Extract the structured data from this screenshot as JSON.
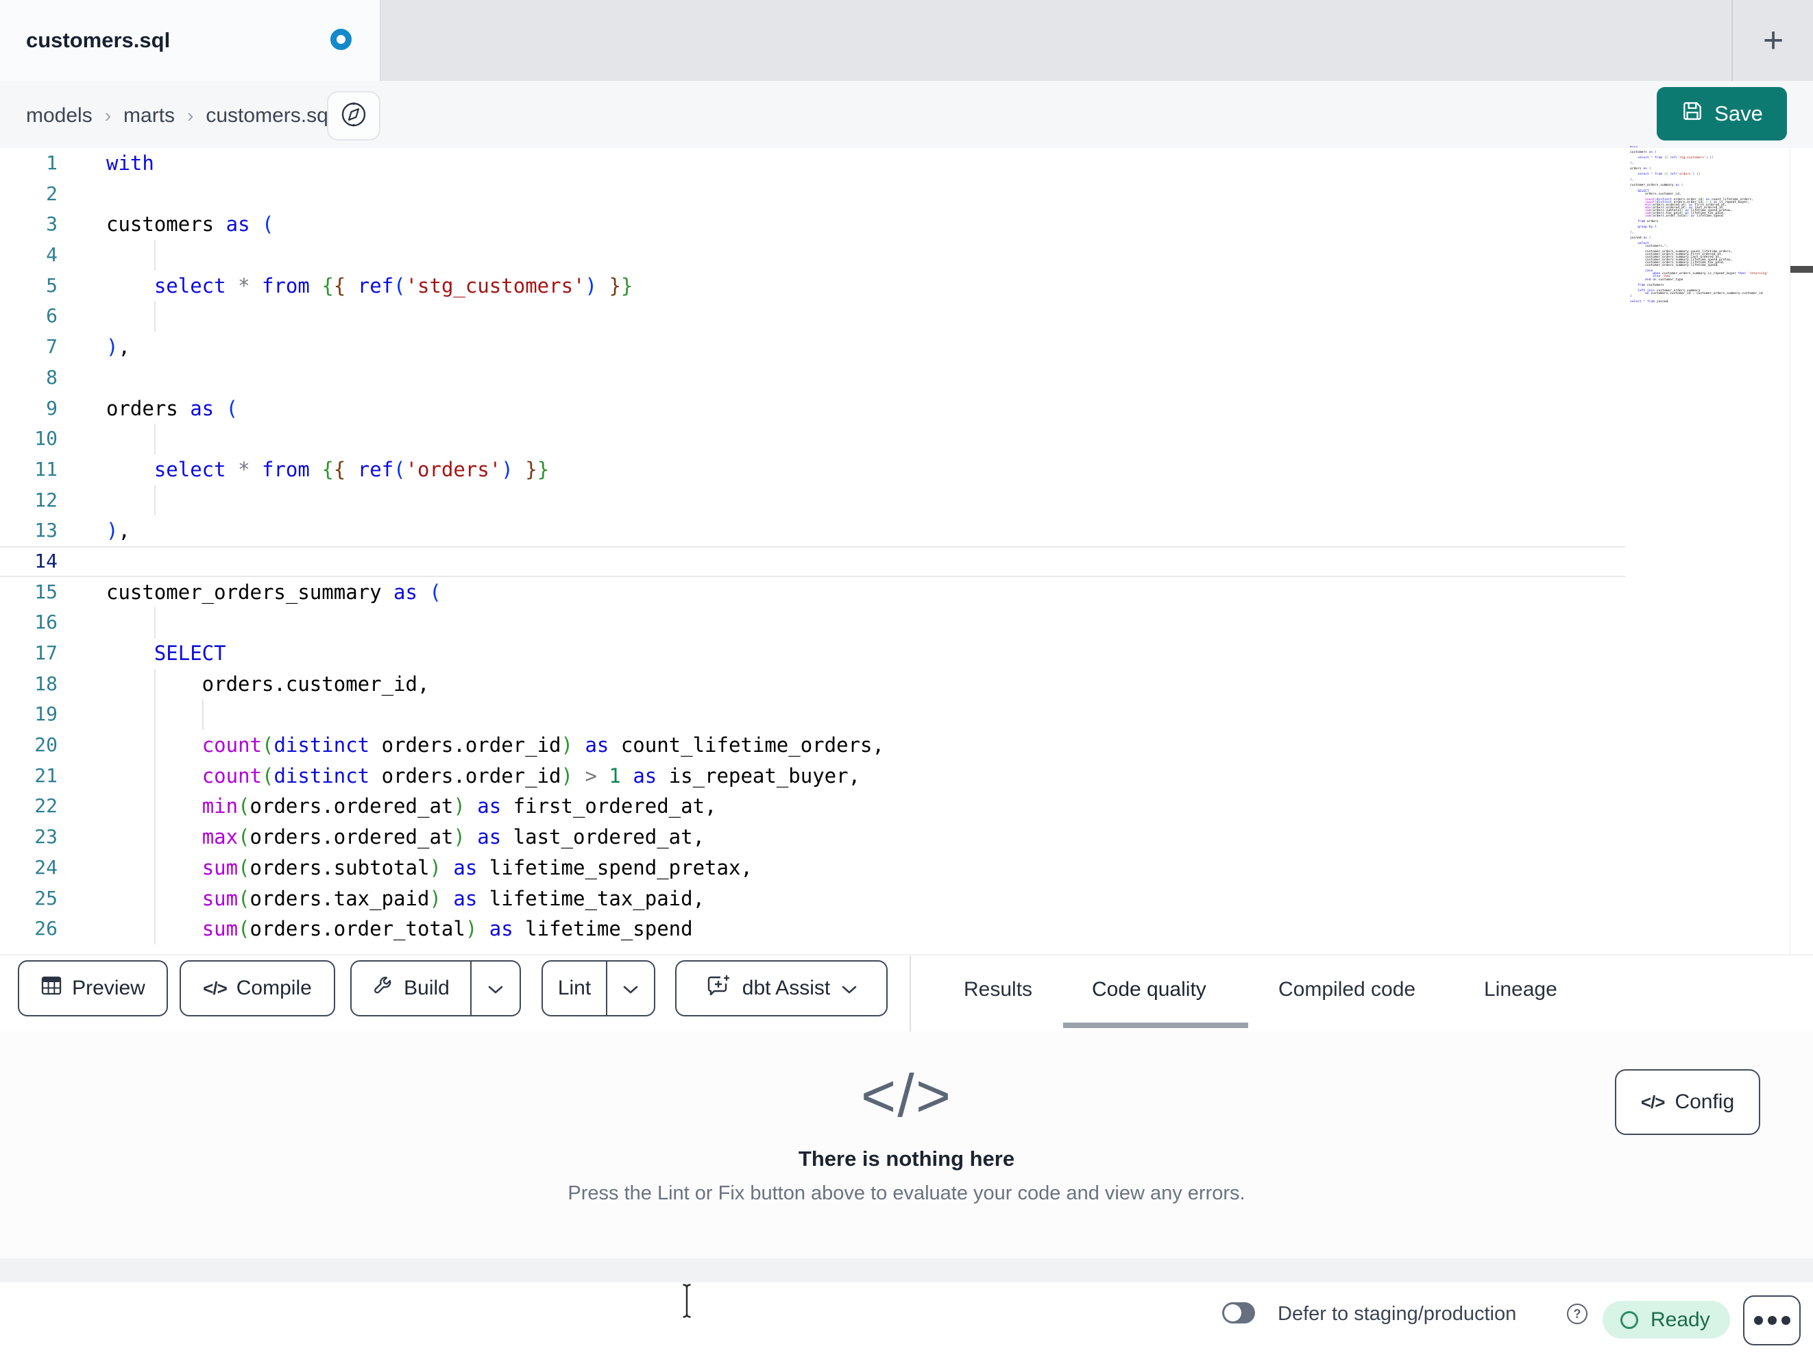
{
  "tabbar": {
    "tab_title": "customers.sql",
    "new_tab_label": "+"
  },
  "breadcrumb": {
    "items": [
      "models",
      "marts",
      "customers.sql"
    ],
    "separator": "›"
  },
  "save_button": {
    "label": "Save"
  },
  "theme": {
    "accent_teal": "#0d7a72",
    "unsaved_dot_blue": "#1489cb",
    "ready_bg": "#d8f4e6",
    "ready_text": "#1a6b4e",
    "active_tab_underline": "#9aa1ab",
    "tab_strip_bg": "#e4e5e8",
    "breadcrumb_bg": "#f6f7f9"
  },
  "editor": {
    "visible_lines": 26,
    "current_line": 14,
    "colors": {
      "kw": "#0b0bdf",
      "fn": "#b000d8",
      "str": "#a31515",
      "num": "#098658",
      "op": "#74787f",
      "tx": "#000000",
      "b1": "#0431fa",
      "b2": "#319331",
      "b3": "#7b3814"
    },
    "lines": [
      {
        "t": [
          [
            "kw",
            "with"
          ]
        ]
      },
      {
        "t": []
      },
      {
        "t": [
          [
            "tx",
            "customers "
          ],
          [
            "kw",
            "as"
          ],
          [
            "tx",
            " "
          ],
          [
            "b1",
            "("
          ]
        ]
      },
      {
        "t": [],
        "g": [
          4
        ]
      },
      {
        "t": [
          [
            "tx",
            "    "
          ],
          [
            "kw",
            "select"
          ],
          [
            "tx",
            " "
          ],
          [
            "op",
            "*"
          ],
          [
            "tx",
            " "
          ],
          [
            "kw",
            "from"
          ],
          [
            "tx",
            " "
          ],
          [
            "b2",
            "{"
          ],
          [
            "b3",
            "{"
          ],
          [
            "tx",
            " "
          ],
          [
            "kw",
            "ref"
          ],
          [
            "b1",
            "("
          ],
          [
            "str",
            "'stg_customers'"
          ],
          [
            "b1",
            ")"
          ],
          [
            "tx",
            " "
          ],
          [
            "b3",
            "}"
          ],
          [
            "b2",
            "}"
          ]
        ]
      },
      {
        "t": [],
        "g": [
          4
        ]
      },
      {
        "t": [
          [
            "b1",
            ")"
          ],
          [
            "tx",
            ","
          ]
        ]
      },
      {
        "t": []
      },
      {
        "t": [
          [
            "tx",
            "orders "
          ],
          [
            "kw",
            "as"
          ],
          [
            "tx",
            " "
          ],
          [
            "b1",
            "("
          ]
        ]
      },
      {
        "t": [],
        "g": [
          4
        ]
      },
      {
        "t": [
          [
            "tx",
            "    "
          ],
          [
            "kw",
            "select"
          ],
          [
            "tx",
            " "
          ],
          [
            "op",
            "*"
          ],
          [
            "tx",
            " "
          ],
          [
            "kw",
            "from"
          ],
          [
            "tx",
            " "
          ],
          [
            "b2",
            "{"
          ],
          [
            "b3",
            "{"
          ],
          [
            "tx",
            " "
          ],
          [
            "kw",
            "ref"
          ],
          [
            "b1",
            "("
          ],
          [
            "str",
            "'orders'"
          ],
          [
            "b1",
            ")"
          ],
          [
            "tx",
            " "
          ],
          [
            "b3",
            "}"
          ],
          [
            "b2",
            "}"
          ]
        ]
      },
      {
        "t": [],
        "g": [
          4
        ]
      },
      {
        "t": [
          [
            "b1",
            ")"
          ],
          [
            "tx",
            ","
          ]
        ]
      },
      {
        "t": []
      },
      {
        "t": [
          [
            "tx",
            "customer_orders_summary "
          ],
          [
            "kw",
            "as"
          ],
          [
            "tx",
            " "
          ],
          [
            "b1",
            "("
          ]
        ]
      },
      {
        "t": [],
        "g": [
          4
        ]
      },
      {
        "t": [
          [
            "tx",
            "    "
          ],
          [
            "kw",
            "SELECT"
          ]
        ]
      },
      {
        "t": [
          [
            "tx",
            "        orders.customer_id,"
          ]
        ],
        "g": [
          4
        ]
      },
      {
        "t": [],
        "g": [
          4,
          8
        ]
      },
      {
        "t": [
          [
            "tx",
            "        "
          ],
          [
            "fn",
            "count"
          ],
          [
            "b2",
            "("
          ],
          [
            "kw",
            "distinct"
          ],
          [
            "tx",
            " orders.order_id"
          ],
          [
            "b2",
            ")"
          ],
          [
            "tx",
            " "
          ],
          [
            "kw",
            "as"
          ],
          [
            "tx",
            " count_lifetime_orders,"
          ]
        ],
        "g": [
          4
        ]
      },
      {
        "t": [
          [
            "tx",
            "        "
          ],
          [
            "fn",
            "count"
          ],
          [
            "b2",
            "("
          ],
          [
            "kw",
            "distinct"
          ],
          [
            "tx",
            " orders.order_id"
          ],
          [
            "b2",
            ")"
          ],
          [
            "tx",
            " "
          ],
          [
            "op",
            ">"
          ],
          [
            "tx",
            " "
          ],
          [
            "num",
            "1"
          ],
          [
            "tx",
            " "
          ],
          [
            "kw",
            "as"
          ],
          [
            "tx",
            " is_repeat_buyer,"
          ]
        ],
        "g": [
          4
        ]
      },
      {
        "t": [
          [
            "tx",
            "        "
          ],
          [
            "fn",
            "min"
          ],
          [
            "b2",
            "("
          ],
          [
            "tx",
            "orders.ordered_at"
          ],
          [
            "b2",
            ")"
          ],
          [
            "tx",
            " "
          ],
          [
            "kw",
            "as"
          ],
          [
            "tx",
            " first_ordered_at,"
          ]
        ],
        "g": [
          4
        ]
      },
      {
        "t": [
          [
            "tx",
            "        "
          ],
          [
            "fn",
            "max"
          ],
          [
            "b2",
            "("
          ],
          [
            "tx",
            "orders.ordered_at"
          ],
          [
            "b2",
            ")"
          ],
          [
            "tx",
            " "
          ],
          [
            "kw",
            "as"
          ],
          [
            "tx",
            " last_ordered_at,"
          ]
        ],
        "g": [
          4
        ]
      },
      {
        "t": [
          [
            "tx",
            "        "
          ],
          [
            "fn",
            "sum"
          ],
          [
            "b2",
            "("
          ],
          [
            "tx",
            "orders.subtotal"
          ],
          [
            "b2",
            ")"
          ],
          [
            "tx",
            " "
          ],
          [
            "kw",
            "as"
          ],
          [
            "tx",
            " lifetime_spend_pretax,"
          ]
        ],
        "g": [
          4
        ]
      },
      {
        "t": [
          [
            "tx",
            "        "
          ],
          [
            "fn",
            "sum"
          ],
          [
            "b2",
            "("
          ],
          [
            "tx",
            "orders.tax_paid"
          ],
          [
            "b2",
            ")"
          ],
          [
            "tx",
            " "
          ],
          [
            "kw",
            "as"
          ],
          [
            "tx",
            " lifetime_tax_paid,"
          ]
        ],
        "g": [
          4
        ]
      },
      {
        "t": [
          [
            "tx",
            "        "
          ],
          [
            "fn",
            "sum"
          ],
          [
            "b2",
            "("
          ],
          [
            "tx",
            "orders.order_total"
          ],
          [
            "b2",
            ")"
          ],
          [
            "tx",
            " "
          ],
          [
            "kw",
            "as"
          ],
          [
            "tx",
            " lifetime_spend"
          ]
        ],
        "g": [
          4
        ]
      },
      {
        "t": []
      },
      {
        "t": [
          [
            "tx",
            "    "
          ],
          [
            "kw",
            "from"
          ],
          [
            "tx",
            " orders"
          ]
        ]
      },
      {
        "t": []
      },
      {
        "t": [
          [
            "tx",
            "    "
          ],
          [
            "kw",
            "group by"
          ],
          [
            "tx",
            " "
          ],
          [
            "num",
            "1"
          ]
        ]
      },
      {
        "t": []
      },
      {
        "t": [
          [
            "b1",
            ")"
          ],
          [
            "tx",
            ","
          ]
        ]
      },
      {
        "t": []
      },
      {
        "t": [
          [
            "tx",
            "joined "
          ],
          [
            "kw",
            "as"
          ],
          [
            "tx",
            " "
          ],
          [
            "b1",
            "("
          ]
        ]
      },
      {
        "t": []
      },
      {
        "t": [
          [
            "tx",
            "    "
          ],
          [
            "kw",
            "select"
          ]
        ]
      },
      {
        "t": [
          [
            "tx",
            "        customers."
          ],
          [
            "op",
            "*"
          ],
          [
            "tx",
            ","
          ]
        ]
      },
      {
        "t": []
      },
      {
        "t": [
          [
            "tx",
            "        customer_orders_summary.count_lifetime_orders,"
          ]
        ]
      },
      {
        "t": [
          [
            "tx",
            "        customer_orders_summary.first_ordered_at,"
          ]
        ]
      },
      {
        "t": [
          [
            "tx",
            "        customer_orders_summary.last_ordered_at,"
          ]
        ]
      },
      {
        "t": [
          [
            "tx",
            "        customer_orders_summary.lifetime_spend_pretax,"
          ]
        ]
      },
      {
        "t": [
          [
            "tx",
            "        customer_orders_summary.lifetime_tax_paid,"
          ]
        ]
      },
      {
        "t": [
          [
            "tx",
            "        customer_orders_summary.lifetime_spend,"
          ]
        ]
      },
      {
        "t": []
      },
      {
        "t": [
          [
            "tx",
            "        "
          ],
          [
            "kw",
            "case"
          ]
        ]
      },
      {
        "t": [
          [
            "tx",
            "            "
          ],
          [
            "kw",
            "when"
          ],
          [
            "tx",
            " customer_orders_summary.is_repeat_buyer "
          ],
          [
            "kw",
            "then"
          ],
          [
            "tx",
            " "
          ],
          [
            "str",
            "'returning'"
          ]
        ]
      },
      {
        "t": [
          [
            "tx",
            "            "
          ],
          [
            "kw",
            "else"
          ],
          [
            "tx",
            " "
          ],
          [
            "str",
            "'new'"
          ]
        ]
      },
      {
        "t": [
          [
            "tx",
            "        "
          ],
          [
            "kw",
            "end"
          ],
          [
            "tx",
            " "
          ],
          [
            "kw",
            "as"
          ],
          [
            "tx",
            " customer_type"
          ]
        ]
      },
      {
        "t": []
      },
      {
        "t": [
          [
            "tx",
            "    "
          ],
          [
            "kw",
            "from"
          ],
          [
            "tx",
            " customers"
          ]
        ]
      },
      {
        "t": []
      },
      {
        "t": [
          [
            "tx",
            "    "
          ],
          [
            "kw",
            "left join"
          ],
          [
            "tx",
            " customer_orders_summary"
          ]
        ]
      },
      {
        "t": [
          [
            "tx",
            "        "
          ],
          [
            "kw",
            "on"
          ],
          [
            "tx",
            " customers.customer_id "
          ],
          [
            "op",
            "="
          ],
          [
            "tx",
            " customer_orders_summary.customer_id"
          ]
        ]
      },
      {
        "t": [
          [
            "b1",
            ")"
          ]
        ]
      },
      {
        "t": []
      },
      {
        "t": [
          [
            "kw",
            "select"
          ],
          [
            "tx",
            " "
          ],
          [
            "op",
            "*"
          ],
          [
            "tx",
            " "
          ],
          [
            "kw",
            "from"
          ],
          [
            "tx",
            " joined"
          ]
        ]
      }
    ]
  },
  "toolbar": {
    "preview": "Preview",
    "compile": "Compile",
    "build": "Build",
    "lint": "Lint",
    "dbt_assist": "dbt Assist"
  },
  "panel_tabs": {
    "items": [
      "Results",
      "Code quality",
      "Compiled code",
      "Lineage"
    ],
    "active": "Code quality"
  },
  "empty_state": {
    "icon": "</>",
    "title": "There is nothing here",
    "subtitle": "Press the Lint or Fix button above to evaluate your code and view any errors."
  },
  "config_button": {
    "icon": "</>",
    "label": "Config"
  },
  "statusbar": {
    "defer_label": "Defer to staging/production",
    "ready_label": "Ready"
  }
}
